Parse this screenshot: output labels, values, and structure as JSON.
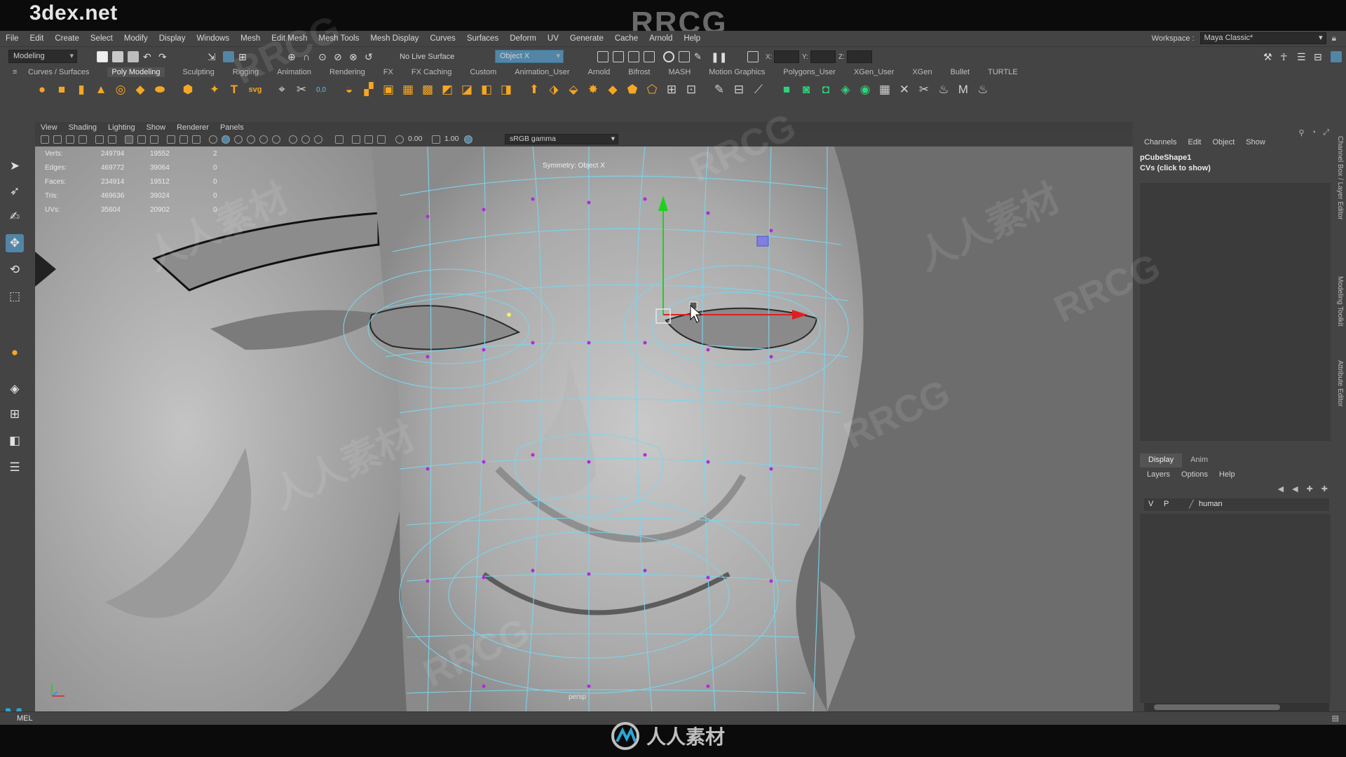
{
  "frame": {
    "site_logo": "3dex.net",
    "top_watermark": "RRCG",
    "footer_watermark": "人人素材",
    "watermarks": [
      "RRCG",
      "人人素材"
    ]
  },
  "menubar": {
    "items": [
      "File",
      "Edit",
      "Create",
      "Select",
      "Modify",
      "Display",
      "Windows",
      "Mesh",
      "Edit Mesh",
      "Mesh Tools",
      "Mesh Display",
      "Curves",
      "Surfaces",
      "Deform",
      "UV",
      "Generate",
      "Cache",
      "Arnold",
      "Help"
    ],
    "workspace_label": "Workspace :",
    "workspace_value": "Maya Classic*"
  },
  "statusline": {
    "mode": "Modeling",
    "live_surface": "No Live Surface",
    "symmetry": "Object X",
    "x_label": "X:",
    "y_label": "Y:",
    "z_label": "Z:"
  },
  "shelf": {
    "tabs": [
      "Curves / Surfaces",
      "Poly Modeling",
      "Sculpting",
      "Rigging",
      "Animation",
      "Rendering",
      "FX",
      "FX Caching",
      "Custom",
      "Animation_User",
      "Arnold",
      "Bifrost",
      "MASH",
      "Motion Graphics",
      "Polygons_User",
      "XGen_User",
      "XGen",
      "Bullet",
      "TURTLE"
    ],
    "active_tab": "Poly Modeling",
    "text_icons": {
      "type": "T",
      "svg": "svg"
    }
  },
  "panel": {
    "menu": [
      "View",
      "Shading",
      "Lighting",
      "Show",
      "Renderer",
      "Panels"
    ],
    "exposure": "0.00",
    "gamma": "1.00",
    "color_space": "sRGB gamma"
  },
  "hud": {
    "rows": [
      {
        "label": "Verts:",
        "a": "249794",
        "b": "19552",
        "c": "2"
      },
      {
        "label": "Edges:",
        "a": "469772",
        "b": "39064",
        "c": "0"
      },
      {
        "label": "Faces:",
        "a": "234914",
        "b": "19512",
        "c": "0"
      },
      {
        "label": "Tris:",
        "a": "469636",
        "b": "39024",
        "c": "0"
      },
      {
        "label": "UVs:",
        "a": "35604",
        "b": "20902",
        "c": "0"
      }
    ],
    "symmetry_label": "Symmetry: Object X",
    "camera": "persp"
  },
  "channel_box": {
    "menu": [
      "Channels",
      "Edit",
      "Object",
      "Show"
    ],
    "object_name": "pCubeShape1",
    "cvs_label": "CVs (click to show)"
  },
  "layer_editor": {
    "tabs": [
      "Display",
      "Anim"
    ],
    "active_tab": "Display",
    "menu": [
      "Layers",
      "Options",
      "Help"
    ],
    "layers": [
      {
        "visible": "V",
        "playback": "P",
        "name": "human"
      }
    ]
  },
  "side_tabs": [
    "Channel Box / Layer Editor",
    "Modeling Toolkit",
    "Attribute Editor"
  ],
  "command_line": {
    "label": "MEL"
  },
  "colors": {
    "accent": "#5285a6",
    "wire": "#7ad7f0",
    "vertex": "#b02bd8",
    "axis_x": "#e02020",
    "axis_y": "#20d020"
  }
}
